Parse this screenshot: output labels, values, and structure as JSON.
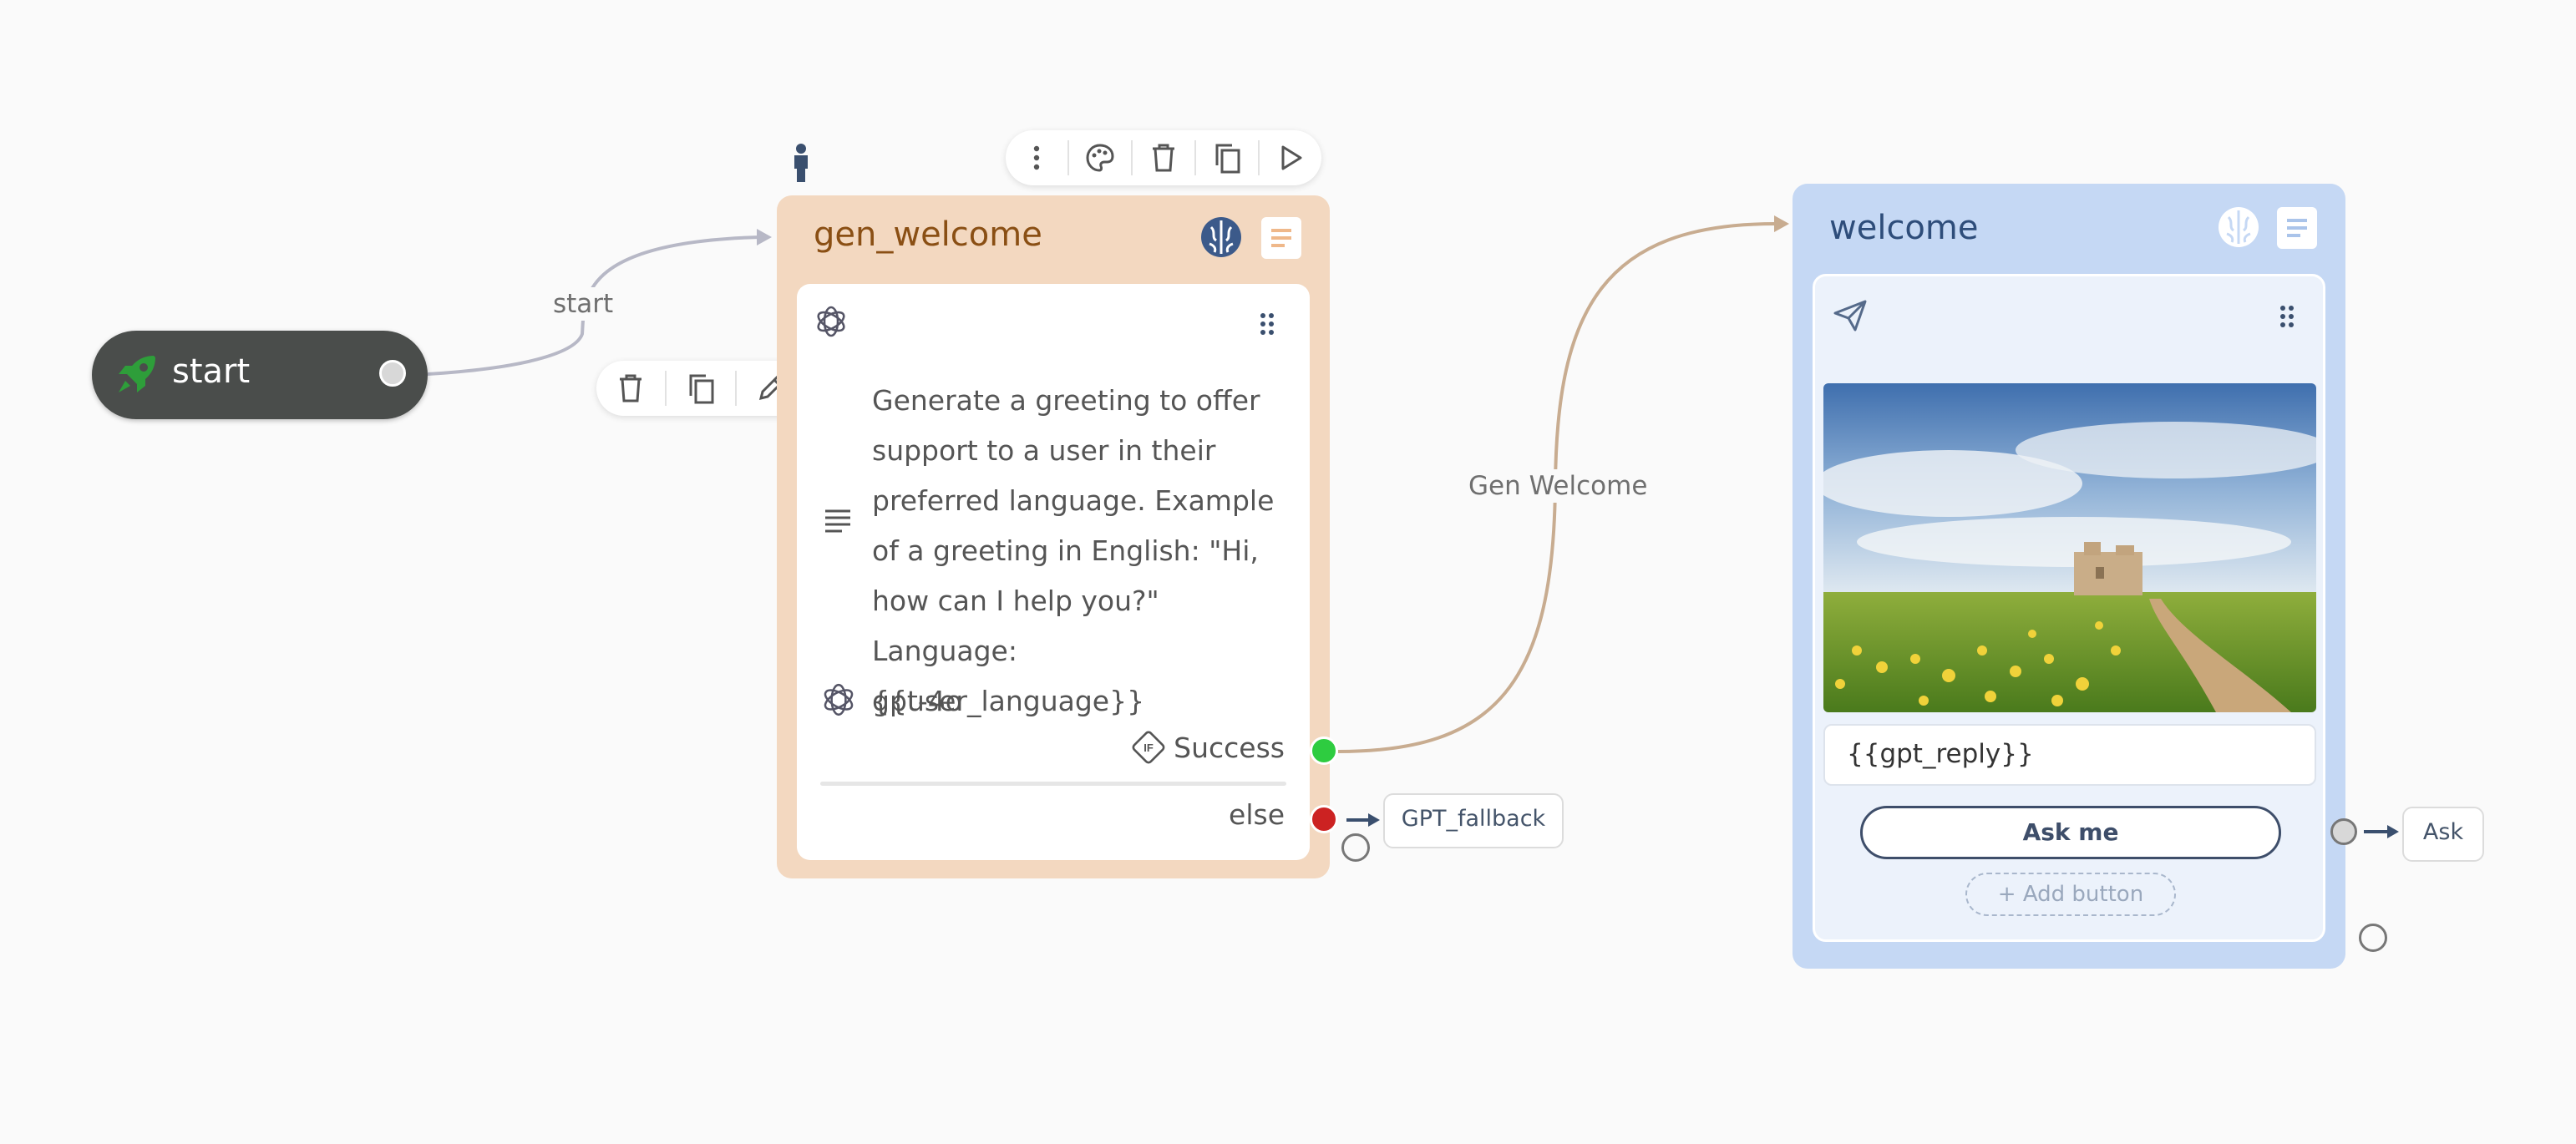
{
  "canvas": {
    "edges": [
      {
        "label": "start"
      },
      {
        "label": "Gen Welcome"
      }
    ]
  },
  "start_node": {
    "label": "start",
    "icon": "rocket-icon",
    "accent": "#2e9e3a"
  },
  "edge_toolbar": {
    "actions": [
      "delete-icon",
      "copy-icon",
      "edit-icon"
    ]
  },
  "node_toolbar": {
    "actions": [
      "more-icon",
      "palette-icon",
      "delete-icon",
      "copy-icon",
      "play-icon"
    ]
  },
  "gen_welcome": {
    "title": "gen_welcome",
    "header_icons": [
      "brain-icon",
      "document-icon"
    ],
    "block_icon": "openai-icon",
    "prompt": "Generate a greeting to offer support to a user in their preferred language. Example of a greeting in English: \"Hi, how can I help you?\" Language: {{user_language}}",
    "model": "gpt-4o",
    "success_label": "Success",
    "else_label": "else",
    "colors": {
      "card": "#f3d8c0",
      "title": "#8a4f14",
      "success": "#2ecc40",
      "else": "#cc2222"
    }
  },
  "fallback_link": {
    "label": "GPT_fallback"
  },
  "welcome": {
    "title": "welcome",
    "header_icons": [
      "brain-icon",
      "document-icon"
    ],
    "block_icon": "send-icon",
    "image": "landscape-image",
    "reply_text": "{{gpt_reply}}",
    "button_label": "Ask me",
    "add_button_label": "+ Add button",
    "colors": {
      "card": "#c5d8f4",
      "title": "#2e4d7a"
    }
  },
  "ask_link": {
    "label": "Ask"
  }
}
